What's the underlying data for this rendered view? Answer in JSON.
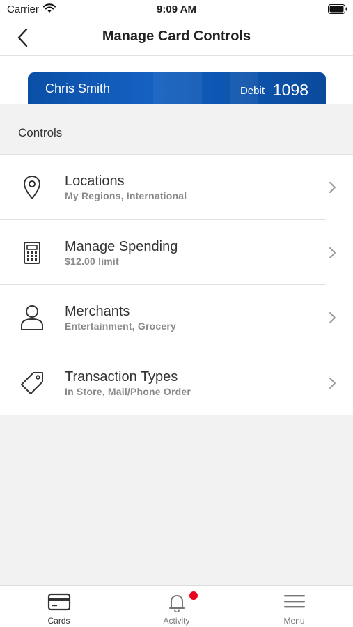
{
  "status_bar": {
    "carrier": "Carrier",
    "time": "9:09 AM",
    "icons": [
      "wifi-icon",
      "battery-icon"
    ]
  },
  "nav": {
    "title": "Manage Card Controls",
    "back_icon": "chevron-left-icon"
  },
  "card": {
    "holder_name": "Chris Smith",
    "type": "Debit",
    "last4": "1098",
    "color": "#0f58b4"
  },
  "section": {
    "title": "Controls"
  },
  "controls": [
    {
      "title": "Locations",
      "subtitle": "My Regions, International",
      "icon": "location-pin-icon"
    },
    {
      "title": "Manage Spending",
      "subtitle": "$12.00 limit",
      "icon": "calculator-icon"
    },
    {
      "title": "Merchants",
      "subtitle": "Entertainment, Grocery",
      "icon": "person-icon"
    },
    {
      "title": "Transaction Types",
      "subtitle": "In Store, Mail/Phone Order",
      "icon": "tag-icon"
    }
  ],
  "tab_bar": {
    "tabs": [
      {
        "label": "Cards",
        "icon": "credit-card-icon",
        "active": true
      },
      {
        "label": "Activity",
        "icon": "bell-icon",
        "active": false
      },
      {
        "label": "Menu",
        "icon": "hamburger-menu-icon",
        "active": false
      }
    ],
    "notification_color": "#e8001c"
  }
}
